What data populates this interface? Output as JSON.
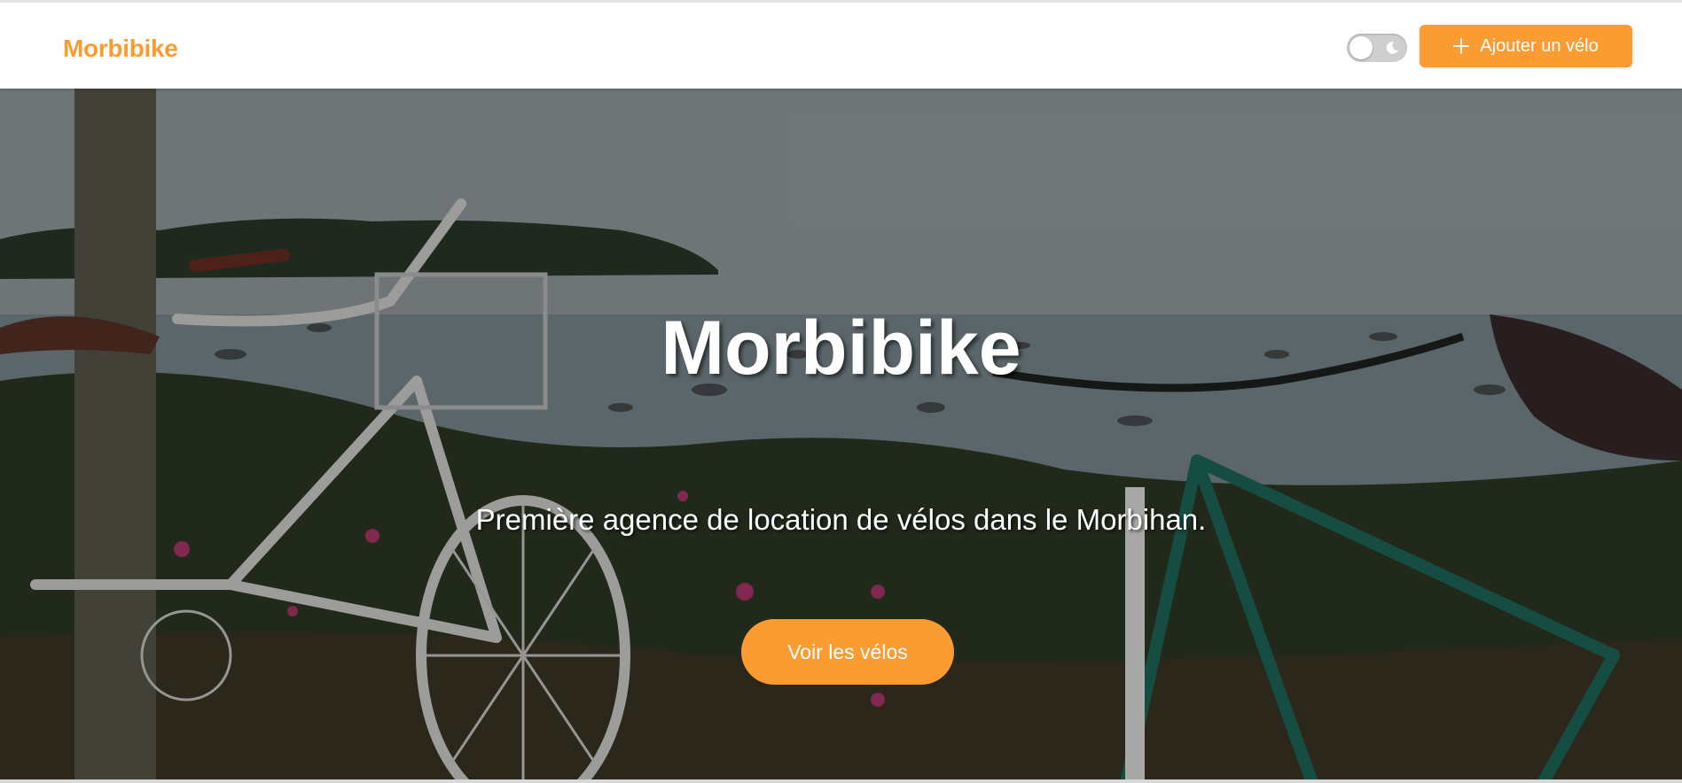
{
  "navbar": {
    "brand": "Morbibike",
    "theme_toggle": {
      "state": "light",
      "icon": "moon-icon"
    },
    "add_button": {
      "label": "Ajouter un vélo",
      "icon": "plus-icon"
    }
  },
  "hero": {
    "title": "Morbibike",
    "subtitle": "Première agence de location de vélos dans le Morbihan.",
    "cta_label": "Voir les vélos",
    "background": "photo of two bicycles by the sea"
  },
  "colors": {
    "accent": "#fb9c33",
    "navbar_bg": "#ffffff",
    "hero_text": "#ffffff"
  }
}
